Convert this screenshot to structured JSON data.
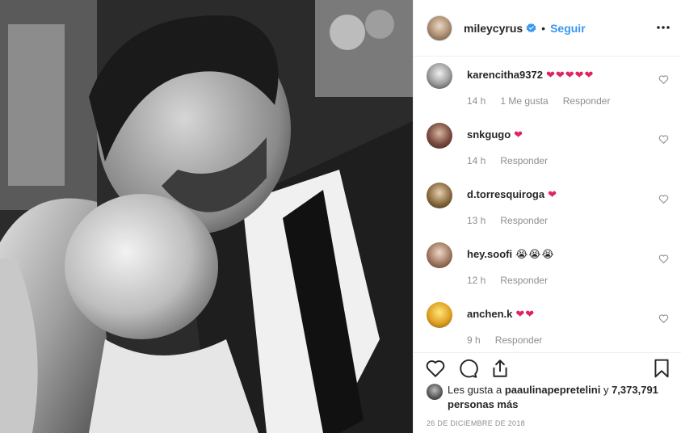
{
  "post": {
    "username": "mileycyrus",
    "dot": "•",
    "follow_label": "Seguir",
    "date": "26 DE DICIEMBRE DE 2018"
  },
  "icons": {
    "verified": "verified-badge-icon",
    "more": "more-options-icon",
    "like": "heart-icon",
    "comment": "comment-icon",
    "share": "share-icon",
    "save": "bookmark-icon"
  },
  "colors": {
    "accent": "#3897f0",
    "heart": "#e0245e",
    "muted": "#8e8e8e",
    "text": "#262626"
  },
  "comments": [
    {
      "user": "karencitha9372",
      "text": "❤❤❤❤❤",
      "time": "14 h",
      "likes": "1 Me gusta",
      "reply": "Responder"
    },
    {
      "user": "snkgugo",
      "text": "❤",
      "time": "14 h",
      "likes": "",
      "reply": "Responder"
    },
    {
      "user": "d.torresquiroga",
      "text": "❤",
      "time": "13 h",
      "likes": "",
      "reply": "Responder"
    },
    {
      "user": "hey.soofi",
      "text": "😭😭😭",
      "time": "12 h",
      "likes": "",
      "reply": "Responder"
    },
    {
      "user": "anchen.k",
      "text": "❤❤",
      "time": "9 h",
      "likes": "",
      "reply": "Responder"
    }
  ],
  "likes": {
    "prefix": "Les gusta a",
    "user": "paaulinapepretelini",
    "connector": "y",
    "count": "7,373,791 personas más"
  }
}
